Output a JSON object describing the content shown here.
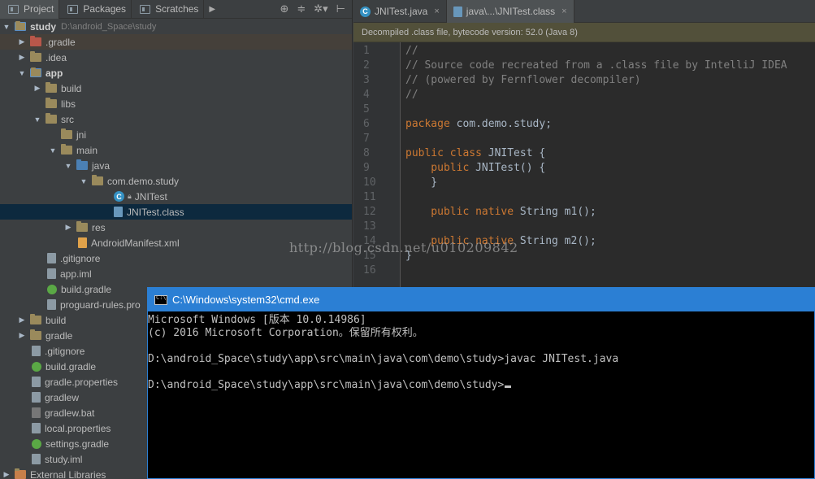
{
  "toolwindow": {
    "tabs": [
      {
        "label": "Project",
        "icon": "project-icon"
      },
      {
        "label": "Packages",
        "icon": "packages-icon"
      },
      {
        "label": "Scratches",
        "icon": "scratches-icon"
      }
    ],
    "tools": [
      "target-icon",
      "collapse-icon",
      "gear-icon",
      "hide-icon"
    ]
  },
  "tree": {
    "root": {
      "label": "study",
      "path": "D:\\android_Space\\study"
    },
    "rows": [
      {
        "label": ".gradle"
      },
      {
        "label": ".idea"
      },
      {
        "label": "app"
      },
      {
        "label": "build"
      },
      {
        "label": "libs"
      },
      {
        "label": "src"
      },
      {
        "label": "jni"
      },
      {
        "label": "main"
      },
      {
        "label": "java"
      },
      {
        "label": "com.demo.study"
      },
      {
        "label": "JNITest"
      },
      {
        "label": "JNITest.class"
      },
      {
        "label": "res"
      },
      {
        "label": "AndroidManifest.xml"
      },
      {
        "label": ".gitignore"
      },
      {
        "label": "app.iml"
      },
      {
        "label": "build.gradle"
      },
      {
        "label": "proguard-rules.pro"
      },
      {
        "label": "build"
      },
      {
        "label": "gradle"
      },
      {
        "label": ".gitignore"
      },
      {
        "label": "build.gradle"
      },
      {
        "label": "gradle.properties"
      },
      {
        "label": "gradlew"
      },
      {
        "label": "gradlew.bat"
      },
      {
        "label": "local.properties"
      },
      {
        "label": "settings.gradle"
      },
      {
        "label": "study.iml"
      },
      {
        "label": "External Libraries"
      }
    ]
  },
  "editor": {
    "tabs": [
      {
        "label": "JNITest.java",
        "close": "×"
      },
      {
        "label": "java\\...\\JNITest.class",
        "close": "×"
      }
    ],
    "banner": "Decompiled .class file, bytecode version: 52.0 (Java 8)",
    "line_numbers": [
      "1",
      "2",
      "3",
      "4",
      "5",
      "6",
      "7",
      "8",
      "9",
      "10",
      "11",
      "12",
      "13",
      "14",
      "15",
      "16"
    ],
    "code": {
      "l1": "//",
      "l2": "// Source code recreated from a .class file by IntelliJ IDEA",
      "l3": "// (powered by Fernflower decompiler)",
      "l4": "//",
      "l6_kw": "package",
      "l6_tx": " com.demo.study;",
      "l8_kw": "public class",
      "l8_tx": " JNITest {",
      "l9_kw": "    public",
      "l9_tx": " JNITest() {",
      "l10": "    }",
      "l12_kw": "    public native",
      "l12_tx": " String m1();",
      "l14_kw": "    public native",
      "l14_tx": " String m2();",
      "l15": "}"
    },
    "watermark": "http://blog.csdn.net/u010209842"
  },
  "cmd": {
    "title": "C:\\Windows\\system32\\cmd.exe",
    "lines": [
      "Microsoft Windows [版本 10.0.14986]",
      "(c) 2016 Microsoft Corporation。保留所有权利。",
      "",
      "D:\\android_Space\\study\\app\\src\\main\\java\\com\\demo\\study>javac JNITest.java",
      "",
      "D:\\android_Space\\study\\app\\src\\main\\java\\com\\demo\\study>"
    ]
  }
}
